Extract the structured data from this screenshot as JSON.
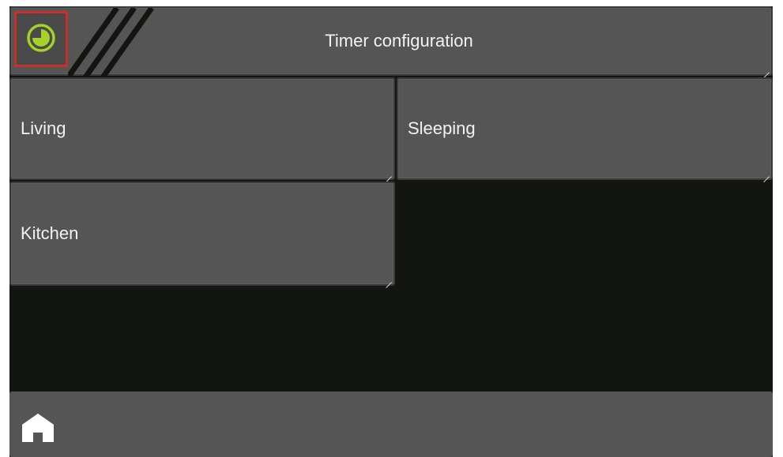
{
  "header": {
    "title": "Timer configuration",
    "timer_icon": "clock-icon",
    "accent_color": "#a6d12a",
    "highlight_color": "#c9302c"
  },
  "rooms": [
    {
      "label": "Living"
    },
    {
      "label": "Sleeping"
    },
    {
      "label": "Kitchen"
    }
  ],
  "footer": {
    "home_icon": "home-icon"
  },
  "colors": {
    "background": "#121510",
    "tile": "#555555",
    "text": "#f2f2f2"
  }
}
